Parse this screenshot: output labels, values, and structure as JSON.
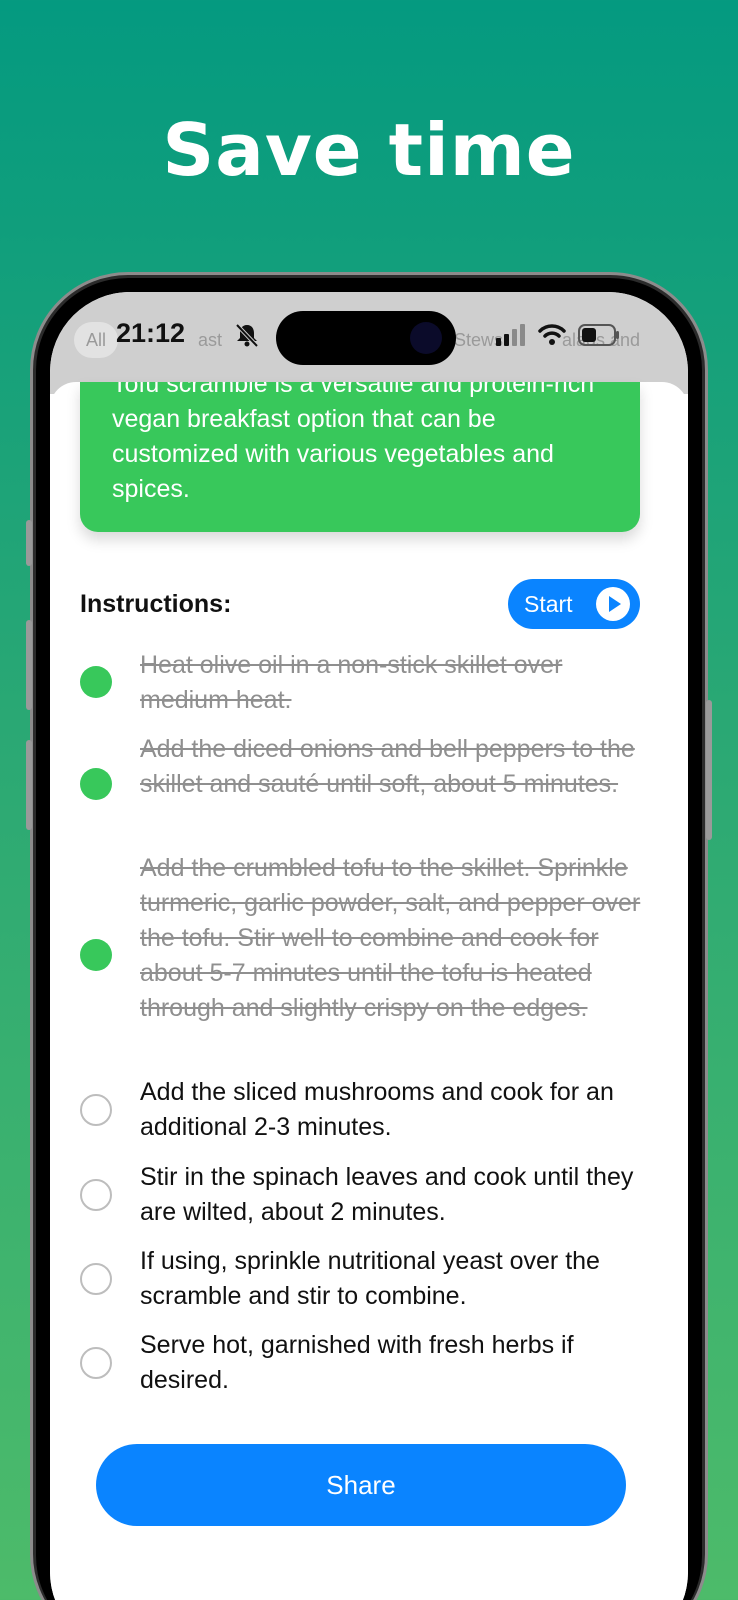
{
  "headline": "Save time",
  "status_bar": {
    "time": "21:12"
  },
  "background_chips": [
    "All",
    "ast",
    "Stews",
    "alads and"
  ],
  "description": "Tofu scramble is a versatile and protein-rich vegan breakfast option that can be customized with various vegetables and spices.",
  "instructions": {
    "title": "Instructions:",
    "start_label": "Start",
    "steps": [
      {
        "text": "Heat olive oil in a non-stick skillet over medium heat.",
        "done": true
      },
      {
        "text": "Add the diced onions and bell peppers to the skillet and sauté until soft, about 5 minutes.",
        "done": true
      },
      {
        "text": "Add the crumbled tofu to the skillet. Sprinkle turmeric, garlic powder, salt, and pepper over the tofu. Stir well to combine and cook for about 5-7 minutes until the tofu is heated through and slightly crispy on the edges.",
        "done": true
      },
      {
        "text": "Add the sliced mushrooms and cook for an additional 2-3 minutes.",
        "done": false
      },
      {
        "text": "Stir in the spinach leaves and cook until they are wilted, about 2 minutes.",
        "done": false
      },
      {
        "text": "If using, sprinkle nutritional yeast over the scramble and stir to combine.",
        "done": false
      },
      {
        "text": "Serve hot, garnished with fresh herbs if desired.",
        "done": false
      }
    ]
  },
  "share_label": "Share",
  "colors": {
    "accent_blue": "#0a84ff",
    "accent_green": "#38c85b",
    "background_top": "#049a80",
    "background_bottom": "#4dbb6a"
  }
}
